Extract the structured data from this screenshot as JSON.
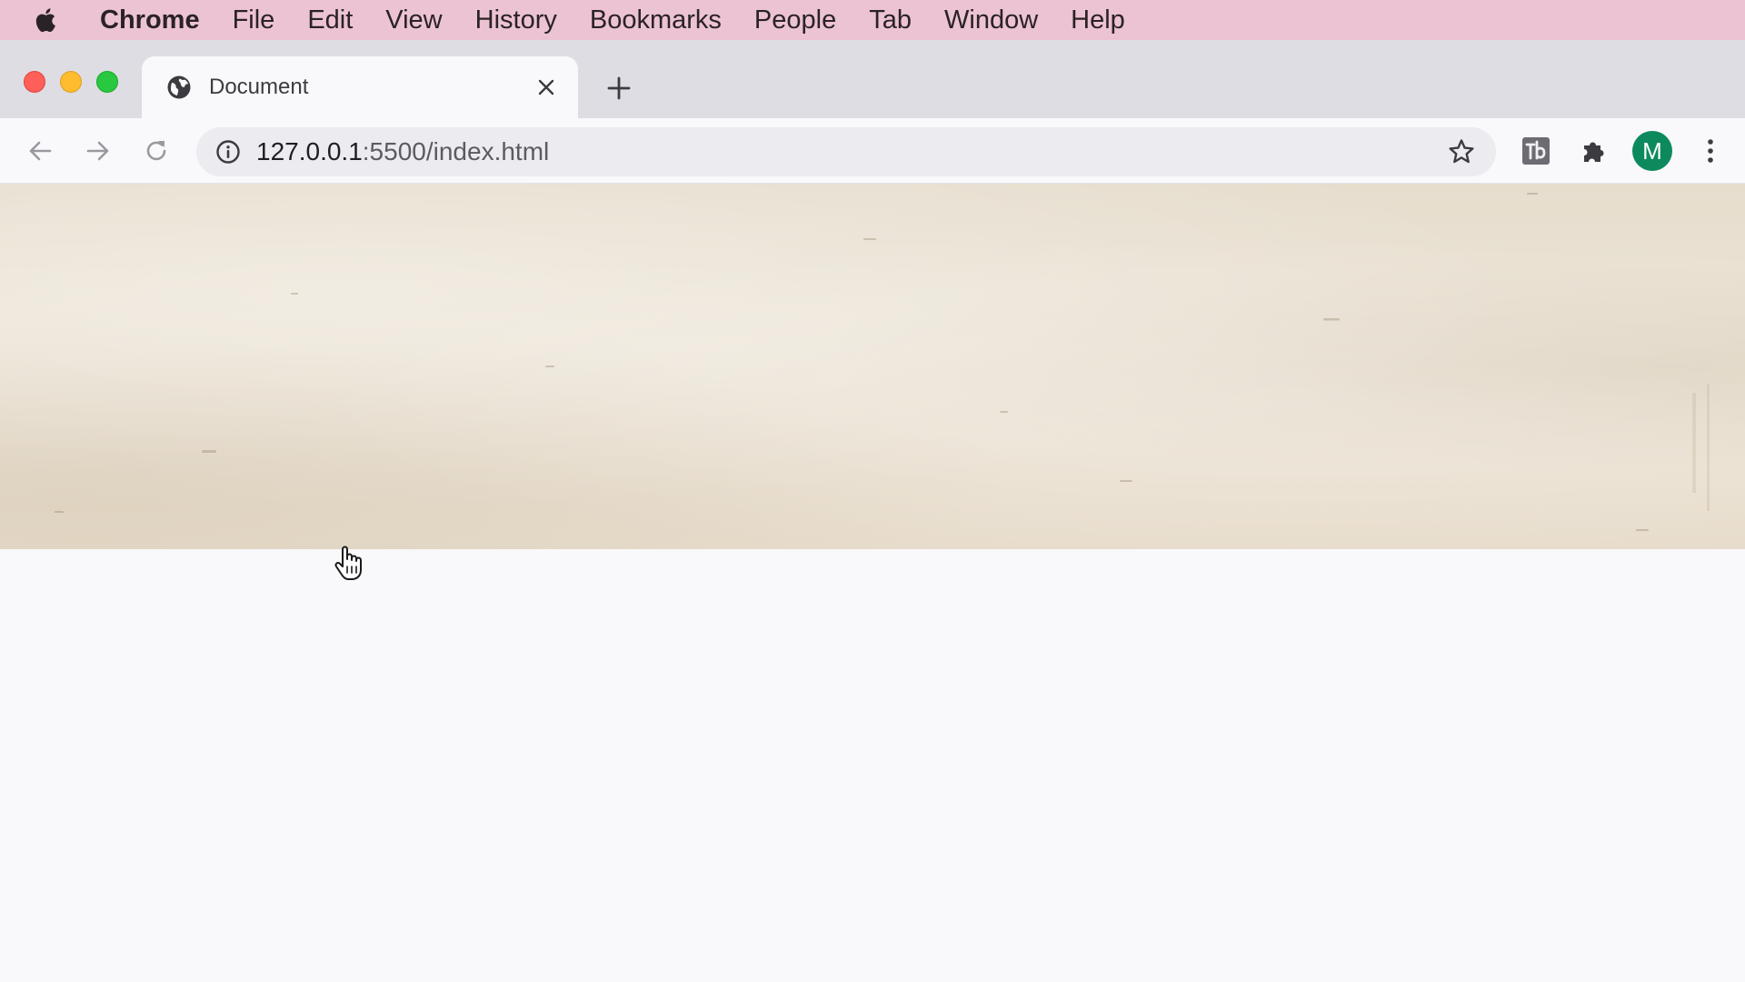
{
  "menubar": {
    "app_name": "Chrome",
    "items": [
      "File",
      "Edit",
      "View",
      "History",
      "Bookmarks",
      "People",
      "Tab",
      "Window",
      "Help"
    ]
  },
  "tab": {
    "title": "Document",
    "favicon": "globe-icon"
  },
  "omnibox": {
    "url_host": "127.0.0.1",
    "url_path": ":5500/index.html"
  },
  "profile": {
    "initial": "M",
    "color": "#0d8a5d"
  },
  "colors": {
    "menubar_bg": "#ecc3d2",
    "parchment": "#e9e0d0",
    "page_bg": "#f9f8fb"
  }
}
